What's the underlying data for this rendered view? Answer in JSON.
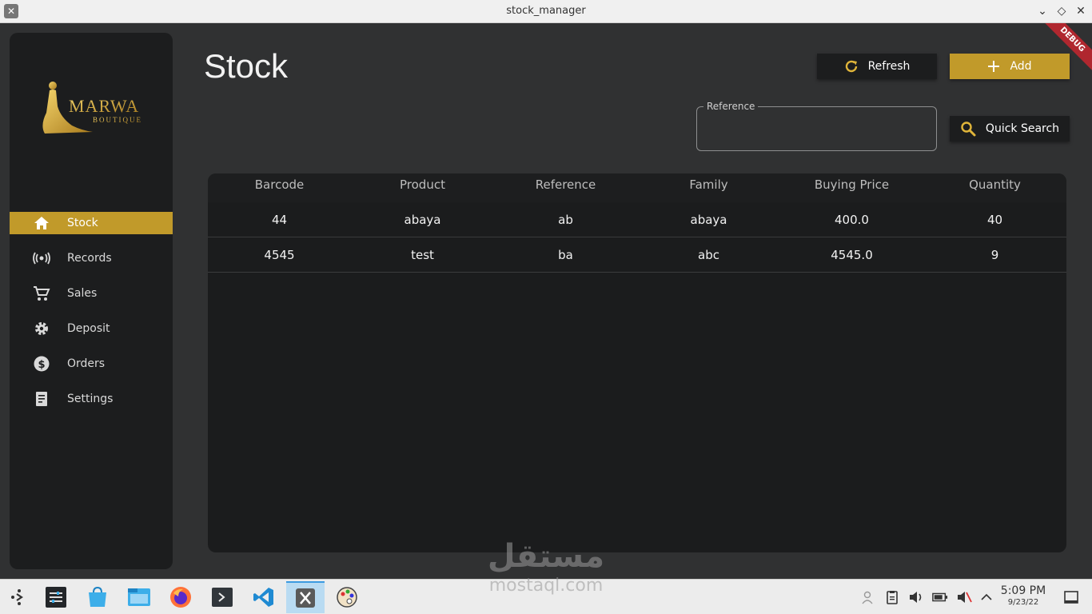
{
  "window": {
    "title": "stock_manager",
    "app_icon": "x-icon",
    "debug_banner": "DEBUG"
  },
  "sidebar": {
    "logo": {
      "main": "MARWA",
      "sub": "BOUTIQUE"
    },
    "items": [
      {
        "label": "Stock",
        "icon": "home-icon",
        "active": true
      },
      {
        "label": "Records",
        "icon": "broadcast-icon",
        "active": false
      },
      {
        "label": "Sales",
        "icon": "cart-icon",
        "active": false
      },
      {
        "label": "Deposit",
        "icon": "gear-icon",
        "active": false
      },
      {
        "label": "Orders",
        "icon": "dollar-icon",
        "active": false
      },
      {
        "label": "Settings",
        "icon": "receipt-icon",
        "active": false
      }
    ]
  },
  "header": {
    "title": "Stock",
    "refresh_label": "Refresh",
    "add_label": "Add",
    "search_label": "Quick Search",
    "reference_label": "Reference",
    "reference_value": ""
  },
  "table": {
    "columns": [
      "Barcode",
      "Product",
      "Reference",
      "Family",
      "Buying Price",
      "Quantity"
    ],
    "rows": [
      [
        "44",
        "abaya",
        "ab",
        "abaya",
        "400.0",
        "40"
      ],
      [
        "4545",
        "test",
        "ba",
        "abc",
        "4545.0",
        "9"
      ]
    ]
  },
  "taskbar": {
    "time": "5:09 PM",
    "date": "9/23/22"
  },
  "watermark": {
    "arabic": "مستقل",
    "latin": "mostaql.com"
  },
  "colors": {
    "accent": "#c19a2a",
    "sidebar_bg": "#1c1d1e",
    "content_bg": "#303132"
  }
}
